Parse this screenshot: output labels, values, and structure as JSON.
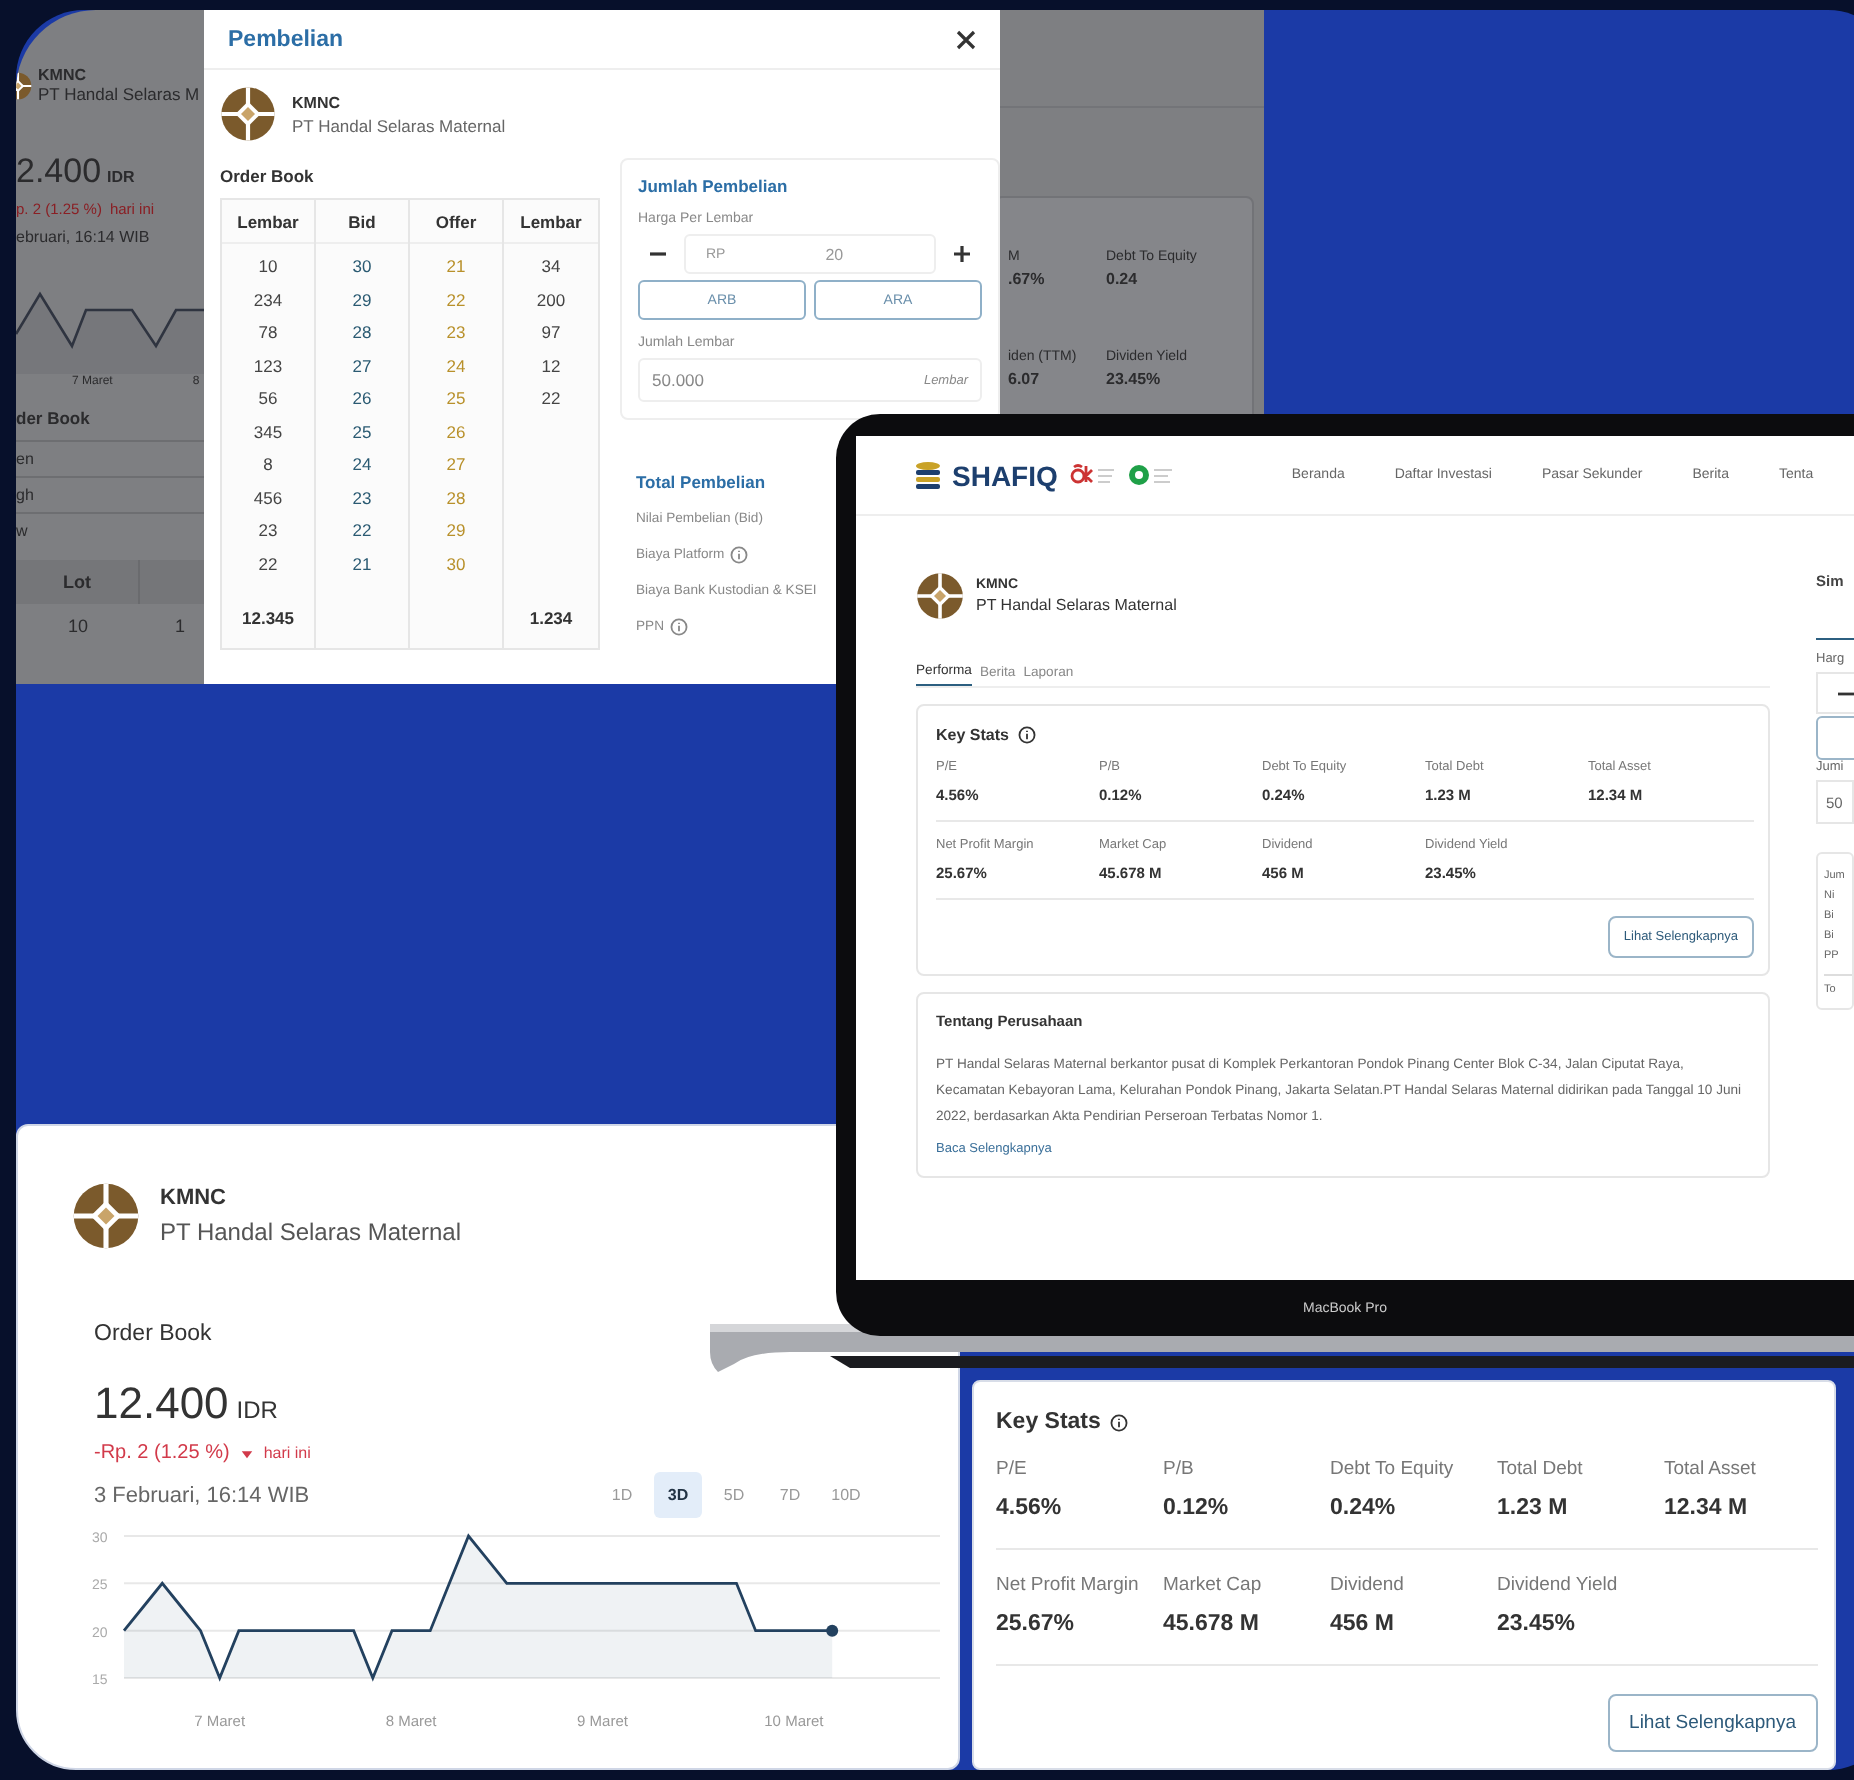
{
  "background_screen": {
    "ticker": "KMNC",
    "company": "PT Handal Selaras M",
    "price": "2.400",
    "currency": "IDR",
    "change": "p. 2 (1.25 %)",
    "change_note": "hari ini",
    "timestamp": "ebruari, 16:14 WIB",
    "axis_labels": [
      "7 Maret",
      "8"
    ],
    "section_title": "der Book",
    "rows": [
      "en",
      "gh",
      "w"
    ],
    "table_header": "Lot",
    "table_cells": [
      "10",
      "1"
    ],
    "stats": [
      {
        "label": "M",
        "value": ".67%"
      },
      {
        "label": "Debt To Equity",
        "value": "0.24"
      },
      {
        "label": "iden (TTM)",
        "value": "6.07"
      },
      {
        "label": "Dividen Yield",
        "value": "23.45%"
      }
    ]
  },
  "purchase_modal": {
    "title": "Pembelian",
    "ticker": "KMNC",
    "company": "PT Handal Selaras Maternal",
    "order_book": {
      "title": "Order Book",
      "columns": [
        "Lembar",
        "Bid",
        "Offer",
        "Lembar"
      ],
      "rows": [
        {
          "bid_lembar": "10",
          "bid": "30",
          "offer": "21",
          "offer_lembar": "34"
        },
        {
          "bid_lembar": "234",
          "bid": "29",
          "offer": "22",
          "offer_lembar": "200"
        },
        {
          "bid_lembar": "78",
          "bid": "28",
          "offer": "23",
          "offer_lembar": "97"
        },
        {
          "bid_lembar": "123",
          "bid": "27",
          "offer": "24",
          "offer_lembar": "12"
        },
        {
          "bid_lembar": "56",
          "bid": "26",
          "offer": "25",
          "offer_lembar": "22"
        },
        {
          "bid_lembar": "345",
          "bid": "25",
          "offer": "26"
        },
        {
          "bid_lembar": "8",
          "bid": "24",
          "offer": "27"
        },
        {
          "bid_lembar": "456",
          "bid": "23",
          "offer": "28"
        },
        {
          "bid_lembar": "23",
          "bid": "22",
          "offer": "29"
        },
        {
          "bid_lembar": "22",
          "bid": "21",
          "offer": "30"
        }
      ],
      "total_bid_lembar": "12.345",
      "total_offer_lembar": "1.234"
    },
    "purchase": {
      "title": "Jumlah Pembelian",
      "price_label": "Harga Per Lembar",
      "currency": "RP",
      "price": "20",
      "buttons": [
        "ARB",
        "ARA"
      ],
      "quantity_label": "Jumlah Lembar",
      "quantity": "50.000",
      "quantity_unit": "Lembar"
    },
    "total": {
      "title": "Total Pembelian",
      "items": [
        {
          "label": "Nilai Pembelian (Bid)",
          "info": false
        },
        {
          "label": "Biaya Platform",
          "info": true
        },
        {
          "label": "Biaya Bank Kustodian & KSEI",
          "info": false
        },
        {
          "label": "PPN",
          "info": true
        }
      ]
    }
  },
  "laptop": {
    "brand": "SHAFIQ",
    "nav": [
      "Beranda",
      "Daftar Investasi",
      "Pasar Sekunder",
      "Berita",
      "Tenta"
    ],
    "ticker": "KMNC",
    "company": "PT Handal Selaras Maternal",
    "tabs": [
      {
        "label": "Performa",
        "selected": true
      },
      {
        "label": "Berita",
        "selected": false
      },
      {
        "label": "Laporan",
        "selected": false
      }
    ],
    "key_stats": {
      "title": "Key Stats",
      "rows": [
        [
          {
            "label": "P/E",
            "value": "4.56%"
          },
          {
            "label": "P/B",
            "value": "0.12%"
          },
          {
            "label": "Debt To Equity",
            "value": "0.24%"
          },
          {
            "label": "Total Debt",
            "value": "1.23 M"
          },
          {
            "label": "Total Asset",
            "value": "12.34 M"
          }
        ],
        [
          {
            "label": "Net Profit Margin",
            "value": "25.67%"
          },
          {
            "label": "Market Cap",
            "value": "45.678 M"
          },
          {
            "label": "Dividend",
            "value": "456 M"
          },
          {
            "label": "Dividend Yield",
            "value": "23.45%"
          }
        ]
      ],
      "button": "Lihat Selengkapnya"
    },
    "about": {
      "title": "Tentang Perusahaan",
      "text": "PT Handal Selaras Maternal berkantor pusat di Komplek Perkantoran Pondok Pinang Center Blok C-34, Jalan Ciputat Raya, Kecamatan Kebayoran Lama, Kelurahan Pondok Pinang, Jakarta Selatan.PT Handal Selaras Maternal didirikan pada Tanggal 10 Juni 2022, berdasarkan Akta Pendirian Perseroan Terbatas Nomor 1.",
      "link": "Baca Selengkapnya"
    },
    "side_panel": {
      "title": "Sim",
      "price_label": "Harg",
      "quantity_label": "Jumi",
      "quantity": "50",
      "total_title": "Jum",
      "items": [
        "Ni",
        "Bi",
        "Bi",
        "PP"
      ],
      "total": "To"
    },
    "model": "MacBook Pro"
  },
  "price_card": {
    "ticker": "KMNC",
    "company": "PT Handal Selaras Maternal",
    "section_title": "Order Book",
    "price": "12.400",
    "currency": "IDR",
    "change": "-Rp. 2 (1.25 %)",
    "change_note": "hari ini",
    "timestamp": "3 Februari, 16:14 WIB",
    "ranges": [
      {
        "label": "1D",
        "selected": false
      },
      {
        "label": "3D",
        "selected": true
      },
      {
        "label": "5D",
        "selected": false
      },
      {
        "label": "7D",
        "selected": false
      },
      {
        "label": "10D",
        "selected": false
      }
    ],
    "chart_data": {
      "type": "area",
      "categories": [
        null,
        null,
        null,
        null,
        null,
        "7 Maret",
        null,
        null,
        null,
        null,
        null,
        null,
        null,
        null,
        null,
        "8 Maret",
        null,
        null,
        null,
        null,
        null,
        null,
        null,
        null,
        null,
        "9 Maret",
        null,
        null,
        null,
        null,
        null,
        null,
        null,
        null,
        null,
        "10 Maret",
        null,
        null
      ],
      "series": [
        {
          "color": "#23415f",
          "values": [
            20,
            22.5,
            25,
            22.5,
            20,
            15,
            20,
            20,
            20,
            20,
            20,
            20,
            20,
            15,
            20,
            20,
            20,
            25,
            30,
            27.5,
            25,
            25,
            25,
            25,
            25,
            25,
            25,
            25,
            25,
            25,
            25,
            25,
            25,
            20,
            20,
            20,
            20,
            20
          ]
        }
      ],
      "ylim": [
        15,
        30
      ],
      "yticks": [
        15,
        20,
        25,
        30
      ]
    }
  },
  "stats_card": {
    "title": "Key Stats",
    "rows": [
      [
        {
          "label": "P/E",
          "value": "4.56%"
        },
        {
          "label": "P/B",
          "value": "0.12%"
        },
        {
          "label": "Debt To Equity",
          "value": "0.24%"
        },
        {
          "label": "Total Debt",
          "value": "1.23 M"
        },
        {
          "label": "Total Asset",
          "value": "12.34 M"
        }
      ],
      [
        {
          "label": "Net Profit Margin",
          "value": "25.67%"
        },
        {
          "label": "Market Cap",
          "value": "45.678 M"
        },
        {
          "label": "Dividend",
          "value": "456 M"
        },
        {
          "label": "Dividend Yield",
          "value": "23.45%"
        }
      ]
    ],
    "button": "Lihat Selengkapnya"
  }
}
